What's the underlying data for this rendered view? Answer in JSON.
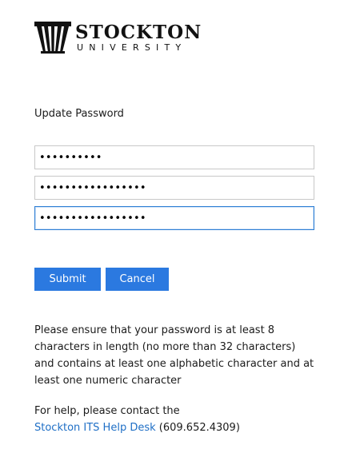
{
  "logo": {
    "name": "STOCKTON",
    "subtitle": "UNIVERSITY"
  },
  "form": {
    "title": "Update Password",
    "fields": [
      {
        "masked_value": "••••••••••"
      },
      {
        "masked_value": "•••••••••••••••••"
      },
      {
        "masked_value": "•••••••••••••••••"
      }
    ],
    "submit_label": "Submit",
    "cancel_label": "Cancel"
  },
  "info": {
    "requirements_text": "Please ensure that your password is at least 8 characters in length (no more than 32 characters) and contains at least one alphabetic character and at least one numeric character"
  },
  "help": {
    "intro": "For help, please contact the",
    "link_text": "Stockton ITS Help Desk",
    "phone": "(609.652.4309)"
  },
  "colors": {
    "button_bg": "#2b79e0",
    "link": "#1f6fc6",
    "focus_border": "#2f7fd4"
  }
}
